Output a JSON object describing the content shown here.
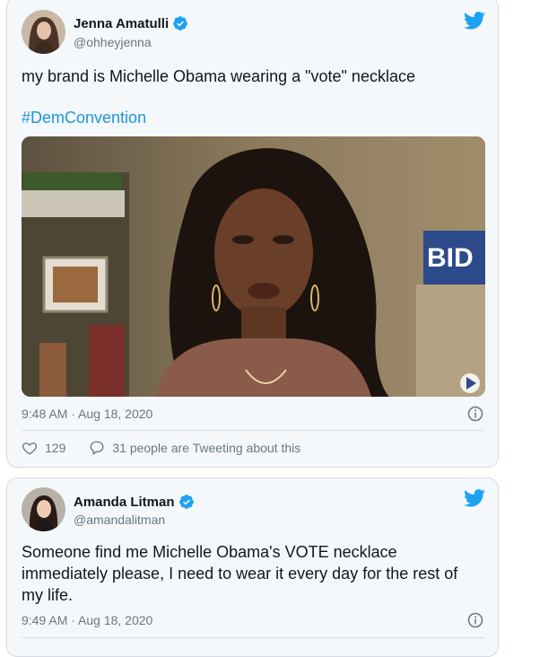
{
  "tweets": [
    {
      "name": "Jenna Amatulli",
      "handle": "@ohheyjenna",
      "text": "my brand is Michelle Obama wearing a \"vote\" necklace",
      "hashtag": "#DemConvention",
      "media_overlay_text": "BID",
      "timestamp": "9:48 AM · Aug 18, 2020",
      "likes": "129",
      "conversation": "31 people are Tweeting about this"
    },
    {
      "name": "Amanda Litman",
      "handle": "@amandalitman",
      "text": "Someone find me Michelle Obama's VOTE necklace immediately please, I need to wear it every day for the rest of my life.",
      "timestamp": "9:49 AM · Aug 18, 2020"
    }
  ],
  "icons": {
    "bird": "twitter-bird-icon",
    "verified": "verified-badge-icon",
    "info": "info-icon",
    "heart": "heart-icon",
    "reply": "speech-bubble-icon",
    "play": "play-icon"
  },
  "colors": {
    "twitter_blue": "#1da1f2",
    "link_blue": "#1b95e0",
    "secondary_text": "#657786",
    "card_bg": "#f5f8fa",
    "border": "#d4dde3"
  }
}
